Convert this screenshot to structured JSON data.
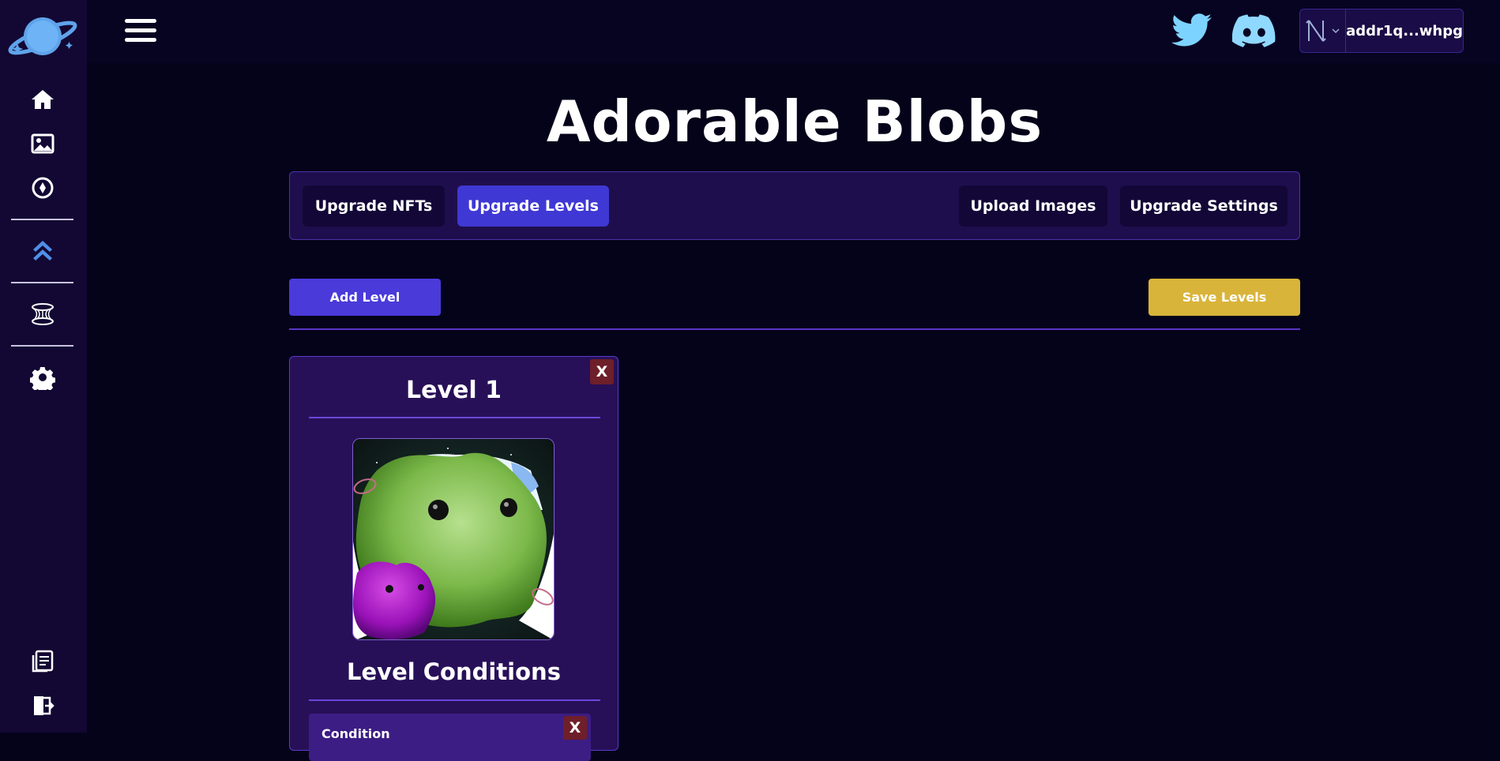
{
  "sidebar": {
    "items": [
      {
        "icon": "home-icon"
      },
      {
        "icon": "image-icon"
      },
      {
        "icon": "compass-icon"
      },
      {
        "icon": "upgrade-chevrons-icon"
      },
      {
        "icon": "wormhole-icon"
      },
      {
        "icon": "gear-icon"
      },
      {
        "icon": "documents-icon"
      },
      {
        "icon": "logout-icon"
      }
    ]
  },
  "header": {
    "wallet_address": "addr1q...whpg",
    "social": [
      "twitter-icon",
      "discord-icon"
    ]
  },
  "page": {
    "title": "Adorable Blobs"
  },
  "tabs": [
    {
      "label": "Upgrade NFTs",
      "active": false
    },
    {
      "label": "Upgrade Levels",
      "active": true
    },
    {
      "label": "Upload Images",
      "active": false
    },
    {
      "label": "Upgrade Settings",
      "active": false
    }
  ],
  "actions": {
    "add_level": "Add Level",
    "save_levels": "Save Levels"
  },
  "level_card": {
    "title": "Level 1",
    "close_label": "X",
    "conditions_title": "Level Conditions",
    "condition": {
      "label": "Condition",
      "close_label": "X"
    }
  },
  "colors": {
    "background": "#05031a",
    "sidebar": "#120833",
    "accent": "#3f38d4",
    "save": "#d9b43a",
    "card": "#281058",
    "social_twitter": "#7dd3ff",
    "social_discord": "#8fd8ff"
  }
}
